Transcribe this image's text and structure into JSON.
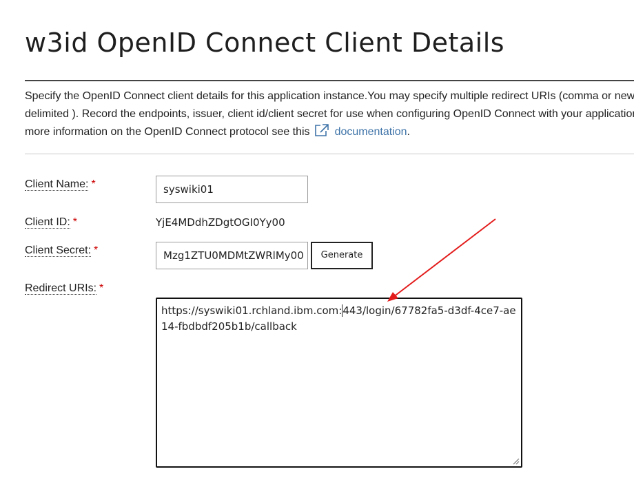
{
  "page": {
    "title": "w3id OpenID Connect Client Details"
  },
  "intro": {
    "line1": "Specify the OpenID Connect client details for this application instance.You may specify multiple redirect URIs (comma or new",
    "line2": "delimited ). Record the endpoints, issuer, client id/client secret for use when configuring OpenID Connect with your application.",
    "line3_prefix": "more information on the OpenID Connect protocol see this",
    "link_text": "documentation",
    "line3_suffix": "."
  },
  "form": {
    "required_marker": "*",
    "client_name": {
      "label": "Client Name:",
      "value": "syswiki01"
    },
    "client_id": {
      "label": "Client ID:",
      "value": "YjE4MDdhZDgtOGI0Yy00"
    },
    "client_secret": {
      "label": "Client Secret:",
      "value": "Mzg1ZTU0MDMtZWRlMy00",
      "button_label": "Generate"
    },
    "redirect_uris": {
      "label": "Redirect URIs:",
      "value_before_cursor": "https://syswiki01.rchland.ibm.com:",
      "value_after_cursor": "443/login/67782fa5-d3df-4ce7-ae14-fbdbdf205b1b/callback"
    }
  },
  "colors": {
    "link": "#3e73a8",
    "required": "#cc0000",
    "annotation_arrow": "#e31b1b"
  },
  "icons": {
    "external_link": "external-link-icon",
    "resize": "resize-grip-icon"
  }
}
